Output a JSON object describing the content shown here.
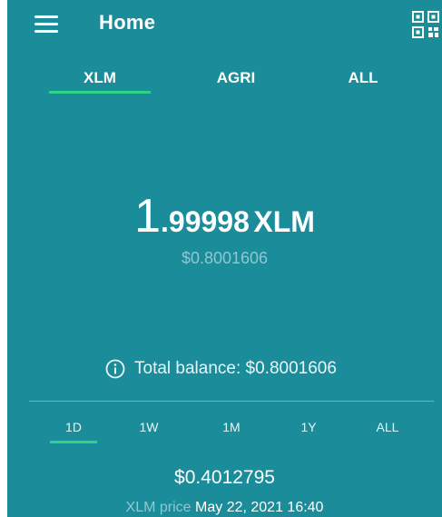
{
  "header": {
    "title": "Home",
    "menu_icon": "hamburger-menu-icon",
    "qr_icon": "qr-code-icon"
  },
  "asset_tabs": [
    {
      "label": "XLM",
      "selected": true
    },
    {
      "label": "AGRI",
      "selected": false
    },
    {
      "label": "ALL",
      "selected": false
    }
  ],
  "balance": {
    "integer": "1",
    "decimal": ".99998",
    "unit": "XLM",
    "usd_value": "$0.8001606"
  },
  "total_balance": {
    "icon": "info-icon",
    "text": "Total balance: $0.8001606"
  },
  "period_tabs": [
    {
      "label": "1D",
      "selected": true
    },
    {
      "label": "1W",
      "selected": false
    },
    {
      "label": "1M",
      "selected": false
    },
    {
      "label": "1Y",
      "selected": false
    },
    {
      "label": "ALL",
      "selected": false
    }
  ],
  "price": {
    "value": "$0.4012795",
    "label": "XLM price",
    "timestamp": "May 22, 2021 16:40"
  },
  "colors": {
    "background": "#1a8c9a",
    "accent": "#2ed38a",
    "muted_text": "#8fc8d0"
  }
}
